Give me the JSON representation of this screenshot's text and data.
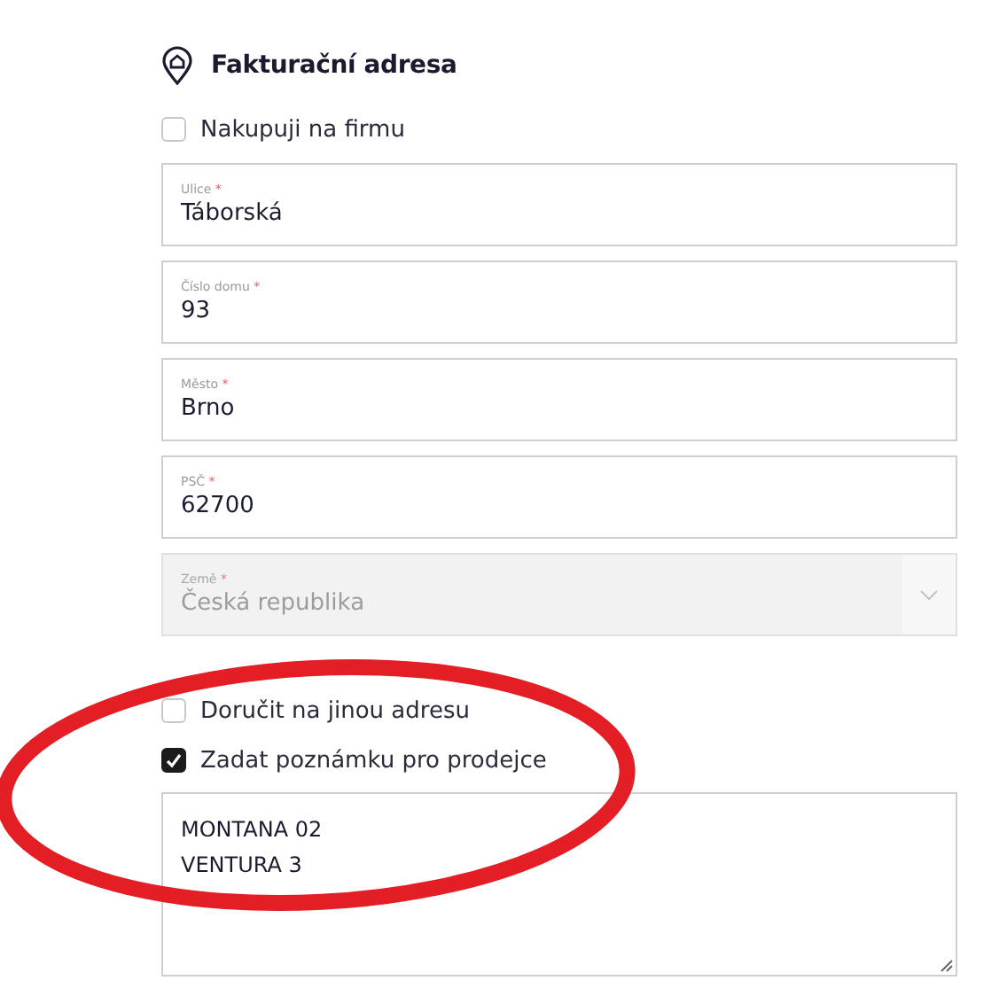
{
  "heading": {
    "title": "Fakturační adresa"
  },
  "company_checkbox": {
    "label": "Nakupuji na firmu",
    "checked": false
  },
  "fields": [
    {
      "kind": "text",
      "label": "Ulice",
      "required_mark": "*",
      "value": "Táborská",
      "disabled": false
    },
    {
      "kind": "text",
      "label": "Číslo domu",
      "required_mark": "*",
      "value": "93",
      "disabled": false
    },
    {
      "kind": "text",
      "label": "Město",
      "required_mark": "*",
      "value": "Brno",
      "disabled": false
    },
    {
      "kind": "text",
      "label": "PSČ",
      "required_mark": "*",
      "value": "62700",
      "disabled": false
    },
    {
      "kind": "select",
      "label": "Země",
      "required_mark": "*",
      "value": "Česká republika",
      "disabled": true
    }
  ],
  "options": [
    {
      "label": "Doručit na jinou adresu",
      "checked": false
    },
    {
      "label": "Zadat poznámku pro prodejce",
      "checked": true
    }
  ],
  "note": {
    "lines": [
      "MONTANA 02",
      "VENTURA 3"
    ]
  }
}
